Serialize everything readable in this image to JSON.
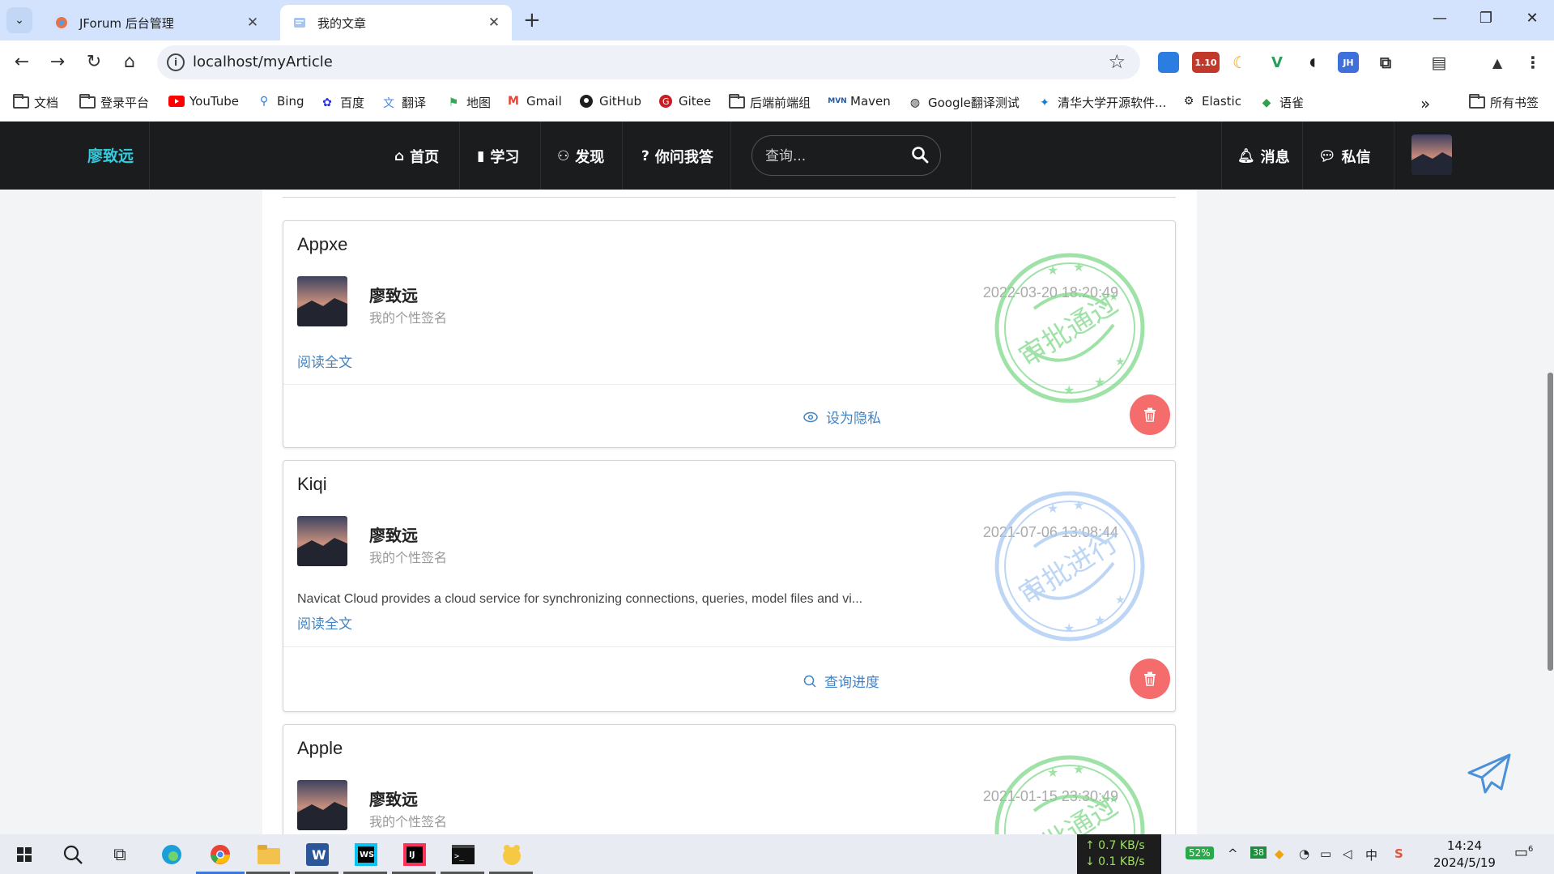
{
  "browser": {
    "tabs": [
      {
        "title": "JForum 后台管理",
        "active": false
      },
      {
        "title": "我的文章",
        "active": true
      }
    ],
    "url": "localhost/myArticle",
    "extensions": {
      "badge": "1.10",
      "jh": "JH"
    },
    "bookmarks": [
      "文档",
      "登录平台",
      "YouTube",
      "Bing",
      "百度",
      "翻译",
      "地图",
      "Gmail",
      "GitHub",
      "Gitee",
      "后端前端组",
      "Maven",
      "Google翻译测试",
      "清华大学开源软件...",
      "Elastic",
      "语雀"
    ],
    "all_bookmarks": "所有书签",
    "more": "»"
  },
  "site": {
    "brand": "廖致远",
    "nav": [
      {
        "label": "首页",
        "icon": "home-icon"
      },
      {
        "label": "学习",
        "icon": "book-icon"
      },
      {
        "label": "发现",
        "icon": "binoculars-icon"
      },
      {
        "label": "你问我答",
        "icon": "question-icon"
      }
    ],
    "search_placeholder": "查询...",
    "messages": "消息",
    "private_msg": "私信"
  },
  "articles": [
    {
      "title": "Appxe",
      "author": "廖致远",
      "signature": "我的个性签名",
      "date": "2022-03-20 18:20:49",
      "excerpt": "",
      "read_more": "阅读全文",
      "action": "设为隐私",
      "action_icon": "eye-icon",
      "stamp": "审批通过",
      "stamp_color": "#7fd98a"
    },
    {
      "title": "Kiqi",
      "author": "廖致远",
      "signature": "我的个性签名",
      "date": "2021-07-06 13:08:44",
      "excerpt": "Navicat Cloud provides a cloud service for synchronizing connections, queries, model files and vi...",
      "read_more": "阅读全文",
      "action": "查询进度",
      "action_icon": "search-icon",
      "stamp": "审批进行",
      "stamp_color": "#a9c9f2"
    },
    {
      "title": "Apple",
      "author": "廖致远",
      "signature": "我的个性签名",
      "date": "2021-01-15 23:30:49",
      "excerpt": "",
      "read_more": "",
      "action": "",
      "action_icon": "",
      "stamp": "审批通过",
      "stamp_color": "#7fd98a"
    }
  ],
  "taskbar": {
    "upload": "↑ 0.7 KB/s",
    "download": "↓ 0.1 KB/s",
    "battery": "52%",
    "tray_badge": "38",
    "ime": "中",
    "time": "14:24",
    "date": "2024/5/19",
    "notifications": "6"
  },
  "colors": {
    "brand": "#31cce0",
    "link": "#4183c4",
    "delete": "#f56c6c",
    "navbar": "#1b1c1d"
  }
}
